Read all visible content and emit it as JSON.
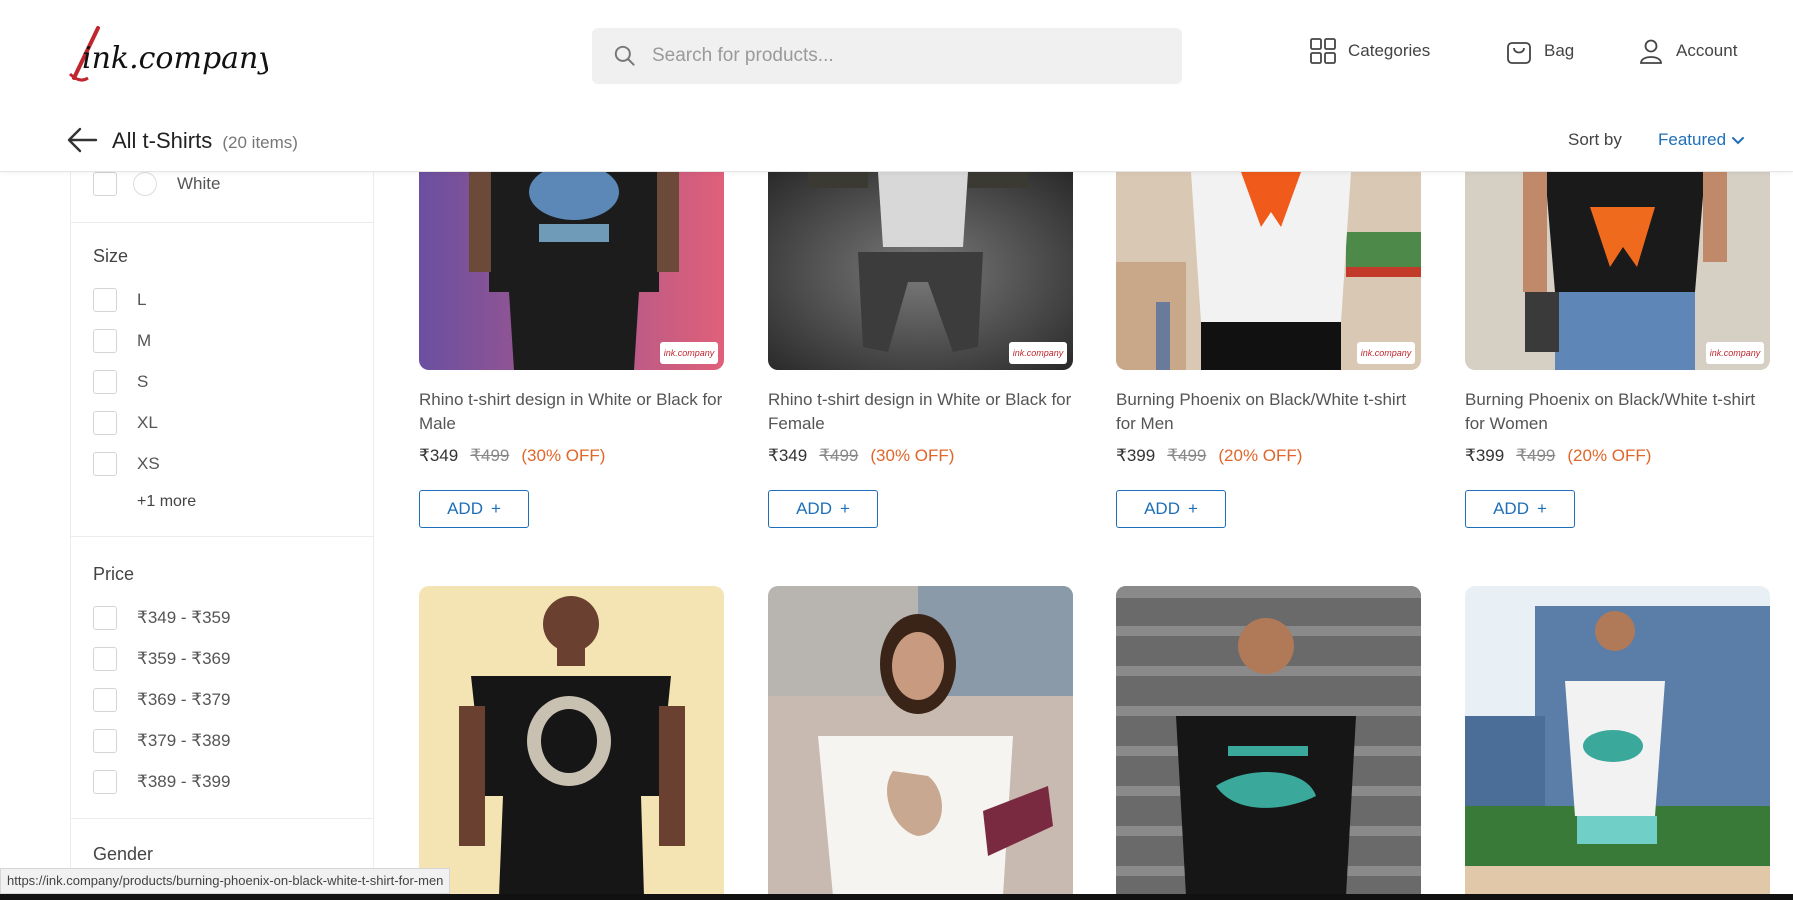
{
  "header": {
    "logo_text": "ink.company",
    "search_placeholder": "Search for products...",
    "nav": {
      "categories": "Categories",
      "bag": "Bag",
      "account": "Account"
    }
  },
  "subbar": {
    "title": "All t-Shirts",
    "count": "(20 items)",
    "sort_label": "Sort by",
    "sort_value": "Featured"
  },
  "sidebar": {
    "color_option": "White",
    "size_title": "Size",
    "sizes": [
      "L",
      "M",
      "S",
      "XL",
      "XS"
    ],
    "size_more": "+1 more",
    "price_title": "Price",
    "prices": [
      "₹349 - ₹359",
      "₹359 - ₹369",
      "₹369 - ₹379",
      "₹379 - ₹389",
      "₹389 - ₹399"
    ],
    "gender_title": "Gender"
  },
  "products": [
    {
      "title": "Rhino t-shirt design in White or Black for Male",
      "price": "₹349",
      "mrp": "₹499",
      "off": "(30% OFF)",
      "add": "ADD"
    },
    {
      "title": "Rhino t-shirt design in White or Black for Female",
      "price": "₹349",
      "mrp": "₹499",
      "off": "(30% OFF)",
      "add": "ADD"
    },
    {
      "title": "Burning Phoenix on Black/White t-shirt for Men",
      "price": "₹399",
      "mrp": "₹499",
      "off": "(20% OFF)",
      "add": "ADD"
    },
    {
      "title": "Burning Phoenix on Black/White t-shirt for Women",
      "price": "₹399",
      "mrp": "₹499",
      "off": "(20% OFF)",
      "add": "ADD"
    }
  ],
  "statusbar": {
    "url": "https://ink.company/products/burning-phoenix-on-black-white-t-shirt-for-men"
  },
  "colors": {
    "accent": "#1e6fb8",
    "discount": "#e0662a",
    "brand_red": "#c0262d"
  }
}
